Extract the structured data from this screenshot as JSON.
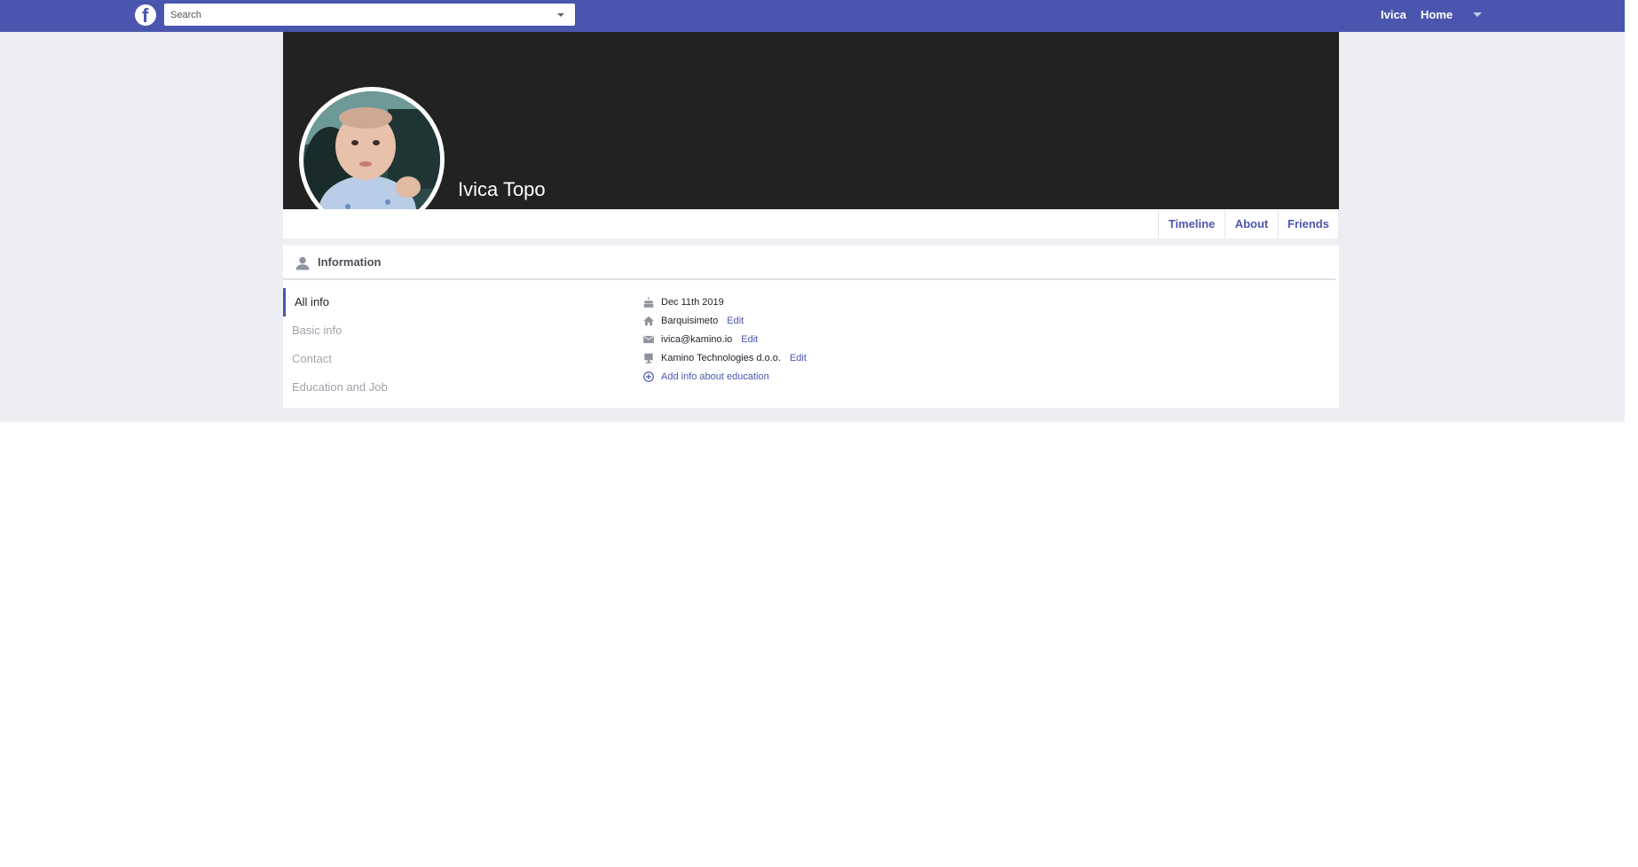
{
  "topbar": {
    "logo_icon": "facebook-logo-icon",
    "search_placeholder": "Search",
    "user_label": "Ivica",
    "home_label": "Home",
    "menu_icon": "caret-down-icon"
  },
  "profile": {
    "name": "Ivica Topo",
    "avatar": "baby-photo"
  },
  "tabs": [
    {
      "label": "Timeline"
    },
    {
      "label": "About"
    },
    {
      "label": "Friends"
    }
  ],
  "information": {
    "title": "Information",
    "sidebar": [
      {
        "label": "All info",
        "active": true
      },
      {
        "label": "Basic info"
      },
      {
        "label": "Contact"
      },
      {
        "label": "Education and Job"
      }
    ],
    "rows": [
      {
        "icon": "cake-icon",
        "text": "Dec 11th 2019"
      },
      {
        "icon": "home-icon",
        "text": "Barquisimeto",
        "edit": "Edit"
      },
      {
        "icon": "mail-icon",
        "text": "ivica@kamino.io",
        "edit": "Edit"
      },
      {
        "icon": "work-icon",
        "text": "Kamino Technologies d.o.o.",
        "edit": "Edit"
      },
      {
        "icon": "add-circle-icon",
        "text": "Add info about education"
      }
    ]
  },
  "colors": {
    "brand": "#4a56ae",
    "cover": "#222222",
    "page_bg": "#eceef3"
  }
}
